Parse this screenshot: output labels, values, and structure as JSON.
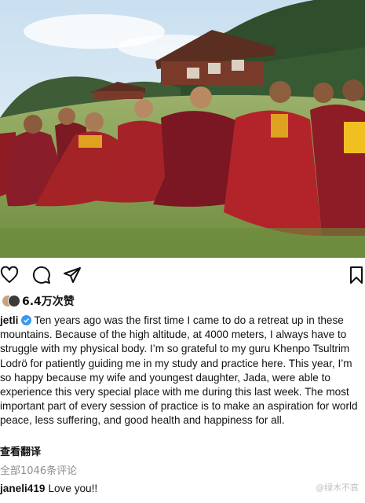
{
  "post": {
    "likes": "6.4万次赞",
    "username": "jetli",
    "caption": "Ten years ago was the first time I came to do a retreat up in these mountains. Because of the high altitude, at 4000 meters, I always have to struggle with my physical body. I’m so grateful to my guru Khenpo Tsultrim Lodrö for patiently guiding me in my study and practice here. This year, I’m so happy because my wife and youngest daughter, Jada, were able to experience this very special place with me during this last week. The most important part of every session of practice is to make an aspiration for world peace, less suffering, and good health and happiness for all.",
    "translate_label": "查看翻译",
    "all_comments_label": "全部1046条评论"
  },
  "comment": {
    "username": "janeli419",
    "text": "Love you!!"
  },
  "watermark": "@绿木不哀",
  "icons": [
    "heart-icon",
    "comment-icon",
    "share-icon",
    "bookmark-icon",
    "verified-icon"
  ],
  "colors": {
    "robe": "#9c1f25",
    "verified": "#3897f0",
    "grass": "#7a9a4a"
  }
}
